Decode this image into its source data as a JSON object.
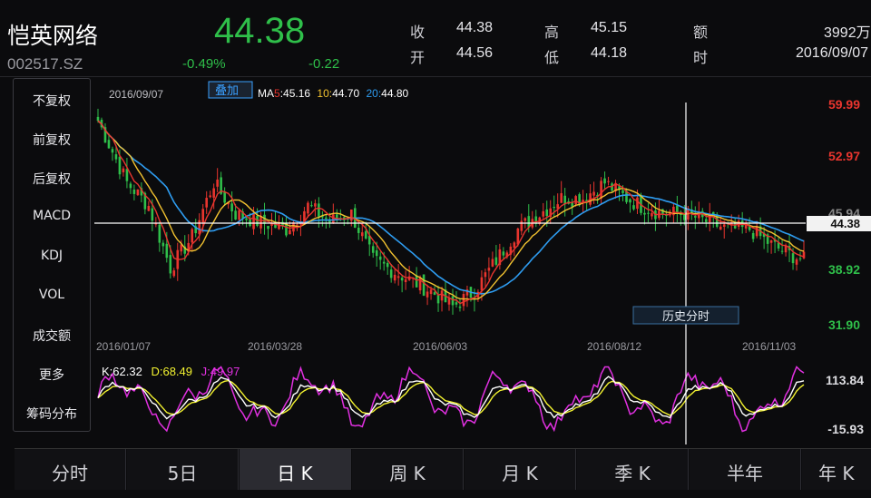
{
  "stock": {
    "name": "恺英网络",
    "code": "002517.SZ",
    "price": "44.38",
    "change_pct": "-0.49%",
    "change": "-0.22"
  },
  "quote": {
    "close_label": "收",
    "close_value": "44.38",
    "open_label": "开",
    "open_value": "44.56",
    "high_label": "高",
    "high_value": "45.15",
    "low_label": "低",
    "low_value": "44.18",
    "amount_label": "额",
    "amount_value": "3992万",
    "time_label": "时",
    "time_value": "2016/09/07"
  },
  "sidebar": {
    "items": [
      {
        "label": "不复权",
        "active": true
      },
      {
        "label": "前复权",
        "active": false
      },
      {
        "label": "后复权",
        "active": false
      },
      {
        "label": "MACD",
        "active": false
      },
      {
        "label": "KDJ",
        "active": true
      },
      {
        "label": "VOL",
        "active": false
      },
      {
        "label": "成交额",
        "active": false
      },
      {
        "label": "更多",
        "active": false
      },
      {
        "label": "筹码分布",
        "active": true
      }
    ]
  },
  "chart": {
    "date": "2016/09/07",
    "overlay_button": "叠加",
    "ma5_label": "MA5:",
    "ma5_value": "45.16",
    "ma10_label": "10:",
    "ma10_value": "44.70",
    "ma20_label": "20:",
    "ma20_value": "44.80",
    "y_labels": [
      "59.99",
      "52.97",
      "45.94",
      "38.92",
      "31.90"
    ],
    "cursor_price": "44.38",
    "history_button": "历史分时",
    "x_labels": [
      "2016/01/07",
      "2016/03/28",
      "2016/06/03",
      "2016/08/12",
      "2016/11/03"
    ],
    "kdj_k_label": "K:",
    "kdj_k_value": "62.32",
    "kdj_d_label": "D:",
    "kdj_d_value": "68.49",
    "kdj_j_label": "J:",
    "kdj_j_value": "49.97",
    "kdj_y_labels": [
      "113.84",
      "-15.93"
    ]
  },
  "colors": {
    "up": "#e8352e",
    "down": "#2fbf4a",
    "ma5": "#e8352e",
    "ma10": "#f2c230",
    "ma20": "#2e9cf0",
    "kdj_k": "#ffffff",
    "kdj_d": "#f2f230",
    "kdj_j": "#e030e0"
  },
  "tabs": [
    {
      "label": "分时",
      "active": false
    },
    {
      "label": "5日",
      "active": false
    },
    {
      "label": "日 K",
      "active": true
    },
    {
      "label": "周 K",
      "active": false
    },
    {
      "label": "月 K",
      "active": false
    },
    {
      "label": "季 K",
      "active": false
    },
    {
      "label": "半年",
      "active": false
    },
    {
      "label": "年 K",
      "active": false
    }
  ]
}
